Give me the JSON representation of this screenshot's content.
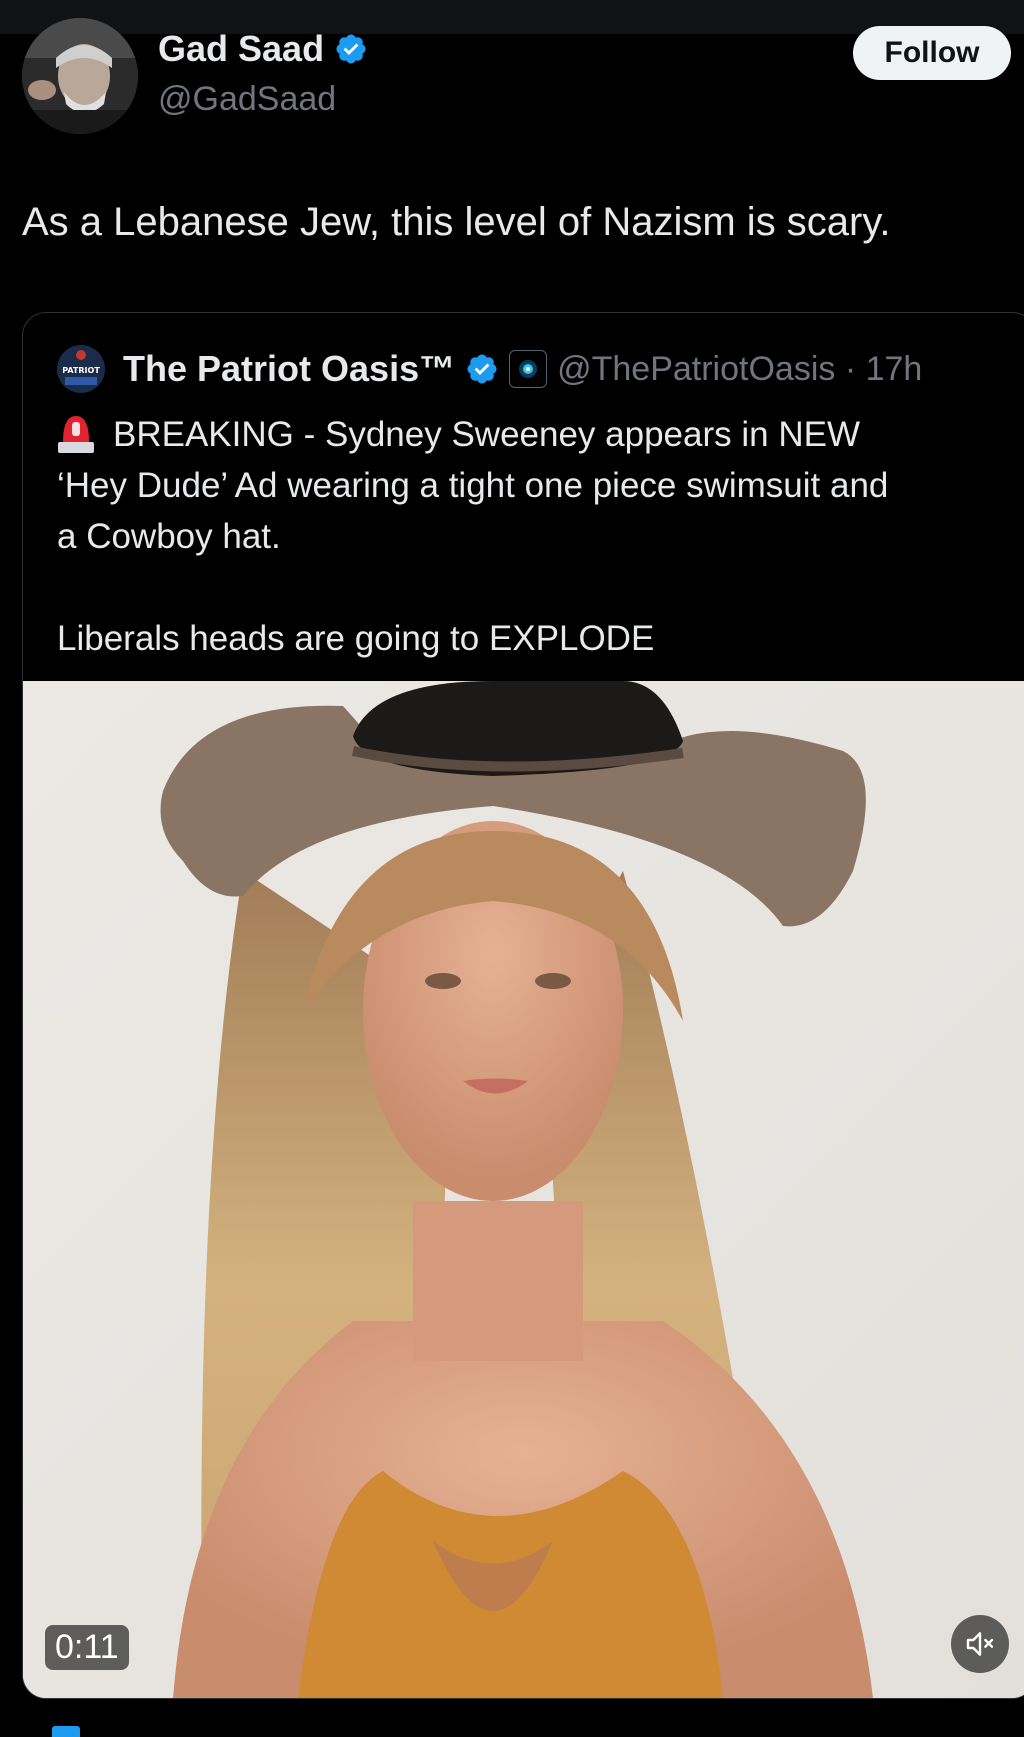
{
  "author": {
    "name": "Gad Saad",
    "handle": "@GadSaad",
    "verified": true
  },
  "follow_button": {
    "label": "Follow"
  },
  "tweet": {
    "text": "As a Lebanese Jew, this level of Nazism is scary."
  },
  "quoted_tweet": {
    "author_name": "The Patriot Oasis™",
    "author_handle": "@ThePatriotOasis · 17h",
    "verified": true,
    "avatar_text": "PATRIOT",
    "lines": [
      "BREAKING - Sydney Sweeney appears in NEW",
      "‘Hey Dude’ Ad wearing a tight one piece swimsuit and",
      "a Cowboy hat."
    ],
    "line_extra": "Liberals heads are going to EXPLODE",
    "icons": {
      "alert": "police-siren-icon",
      "affiliate": "affiliate-badge-icon"
    }
  },
  "video": {
    "timestamp": "0:11",
    "muted": true,
    "mute_icon": "speaker-muted-icon"
  },
  "colors": {
    "background": "#000000",
    "text_primary": "#e7e9ea",
    "text_secondary": "#71767b",
    "verified_blue": "#1d9bf0",
    "border": "#2f3336",
    "follow_bg": "#eff3f4"
  }
}
